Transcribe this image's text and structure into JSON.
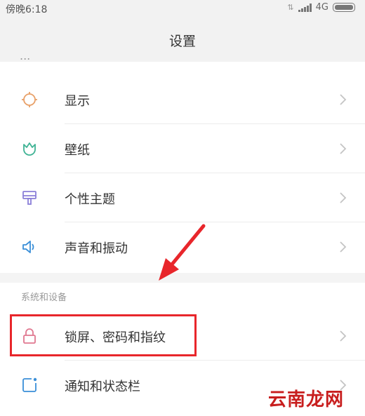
{
  "status_bar": {
    "time": "傍晚6:18",
    "network": "4G"
  },
  "header": {
    "title": "设置"
  },
  "partial_item": {
    "label": "..."
  },
  "items": [
    {
      "label": "显示",
      "icon": "sun-icon",
      "color": "#e8a068"
    },
    {
      "label": "壁纸",
      "icon": "tulip-icon",
      "color": "#3fb394"
    },
    {
      "label": "个性主题",
      "icon": "brush-icon",
      "color": "#8b7fd8"
    },
    {
      "label": "声音和振动",
      "icon": "speaker-icon",
      "color": "#3a8fd8"
    }
  ],
  "section": {
    "title": "系统和设备"
  },
  "system_items": [
    {
      "label": "锁屏、密码和指纹",
      "icon": "lock-icon",
      "color": "#e07890"
    },
    {
      "label": "通知和状态栏",
      "icon": "notification-icon",
      "color": "#3a8fd8"
    }
  ],
  "annotation": {
    "highlight_color": "#e8262b"
  },
  "watermark": {
    "text": "云南龙网"
  }
}
